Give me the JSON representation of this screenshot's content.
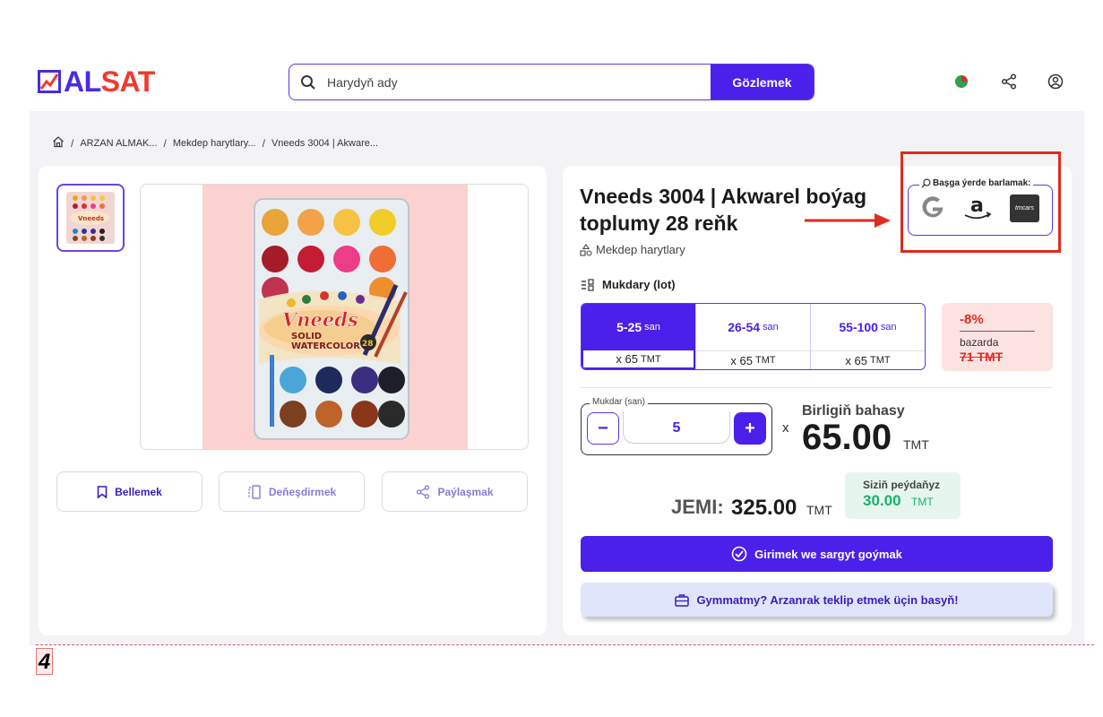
{
  "header": {
    "logo_part1": "AL",
    "logo_part2": "SAT",
    "search_placeholder": "Harydyň ady",
    "search_button": "Gözlemek"
  },
  "breadcrumb": [
    "ARZAN ALMAK...",
    "Mekdep harytlary...",
    "Vneeds 3004 | Akware..."
  ],
  "product": {
    "title": "Vneeds 3004 | Akwarel boýag toplumy 28 reňk",
    "category": "Mekdep harytlary",
    "image_brand": "Vneeds",
    "image_line1": "SOLID",
    "image_line2": "WATERCOLOR",
    "image_count": "28"
  },
  "actions": {
    "save": "Bellemek",
    "compare": "Deňeşdirmek",
    "share": "Paýlaşmak"
  },
  "elsewhere": {
    "label": "Başga ýerde barlamak:",
    "sites": [
      "google-icon",
      "amazon-icon",
      "tmcars-icon"
    ],
    "tmcars_text": "tmcars"
  },
  "lots": {
    "label": "Mukdary (lot)",
    "items": [
      {
        "range": "5-25",
        "unit": "san",
        "price_prefix": "x 65",
        "currency": "TMT",
        "active": true
      },
      {
        "range": "26-54",
        "unit": "san",
        "price_prefix": "x 65",
        "currency": "TMT",
        "active": false
      },
      {
        "range": "55-100",
        "unit": "san",
        "price_prefix": "x 65",
        "currency": "TMT",
        "active": false
      }
    ]
  },
  "discount": {
    "percent": "-8%",
    "label": "bazarda",
    "old_price": "71 TMT"
  },
  "quantity": {
    "legend": "Mukdar (san)",
    "minus": "−",
    "value": "5",
    "plus": "+"
  },
  "unit_price": {
    "multiplier": "x",
    "label": "Birligiň bahasy",
    "value": "65.00",
    "currency": "TMT"
  },
  "total": {
    "label": "JEMI:",
    "value": "325.00",
    "currency": "TMT"
  },
  "profit": {
    "label": "Siziň peýdaňyz",
    "value": "30.00",
    "currency": "TMT"
  },
  "buttons": {
    "order": "Girimek we sargyt goýmak",
    "offer": "Gymmatmy? Arzanrak teklip etmek üçin basyň!"
  },
  "page_number": "4",
  "colors": {
    "brand": "#4a20ea",
    "accent_red": "#e02b1f",
    "profit_green": "#17b26a"
  }
}
